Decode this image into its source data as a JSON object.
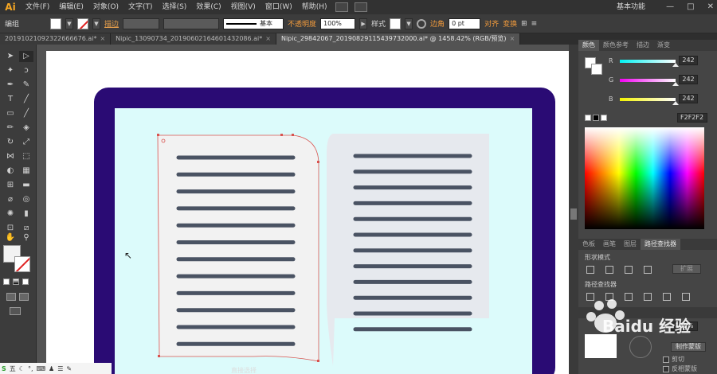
{
  "app": {
    "logo": "Ai"
  },
  "menu": {
    "items": [
      "文件(F)",
      "编辑(E)",
      "对象(O)",
      "文字(T)",
      "选择(S)",
      "效果(C)",
      "视图(V)",
      "窗口(W)",
      "帮助(H)"
    ],
    "workspace": "基本功能",
    "window_buttons": [
      "—",
      "□",
      "✕"
    ]
  },
  "control": {
    "selection_label": "编组",
    "stroke_link": "描边",
    "stroke_style": "基本",
    "opacity_label": "不透明度",
    "opacity_value": "100%",
    "style_label": "样式",
    "corner_label": "边角",
    "corner_value": "0 pt",
    "align_label": "对齐",
    "transform_label": "变换"
  },
  "tabs": [
    {
      "label": "20191021092322666676.ai*",
      "active": false
    },
    {
      "label": "Nipic_13090734_20190602164601432086.ai*",
      "active": false
    },
    {
      "label": "Nipic_29842067_20190829115439732000.ai* @ 1458.42% (RGB/预览)",
      "active": true
    }
  ],
  "color_panel": {
    "tabs": [
      "颜色",
      "颜色参考",
      "描边",
      "渐变"
    ],
    "r_label": "R",
    "r_value": "242",
    "g_label": "G",
    "g_value": "242",
    "b_label": "B",
    "b_value": "242",
    "hex_value": "F2F2F2"
  },
  "pathfinder_panel": {
    "tabs": [
      "色板",
      "画笔",
      "图层",
      "路径查找器"
    ],
    "shape_modes_label": "形状模式",
    "expand_label": "扩展",
    "pathfinders_label": "路径查找器"
  },
  "transparency_panel": {
    "opacity_value": "100%",
    "make_mask_label": "制作蒙版",
    "clip_label": "剪切",
    "invert_mask_label": "反相蒙版"
  },
  "statusbar": {
    "tool_label": "直接选择"
  },
  "taskbar": {
    "ime": "五"
  },
  "watermark": {
    "text": "Baidu 经验"
  },
  "colors": {
    "laptop_frame": "#2a0b74",
    "screen": "#dcfbfb",
    "left_page": "#f2f2f2",
    "right_page": "#e6e9ee",
    "text_line": "#4a5363",
    "selection": "#d9534f"
  },
  "book": {
    "left_lines": 12,
    "right_lines": 12
  }
}
